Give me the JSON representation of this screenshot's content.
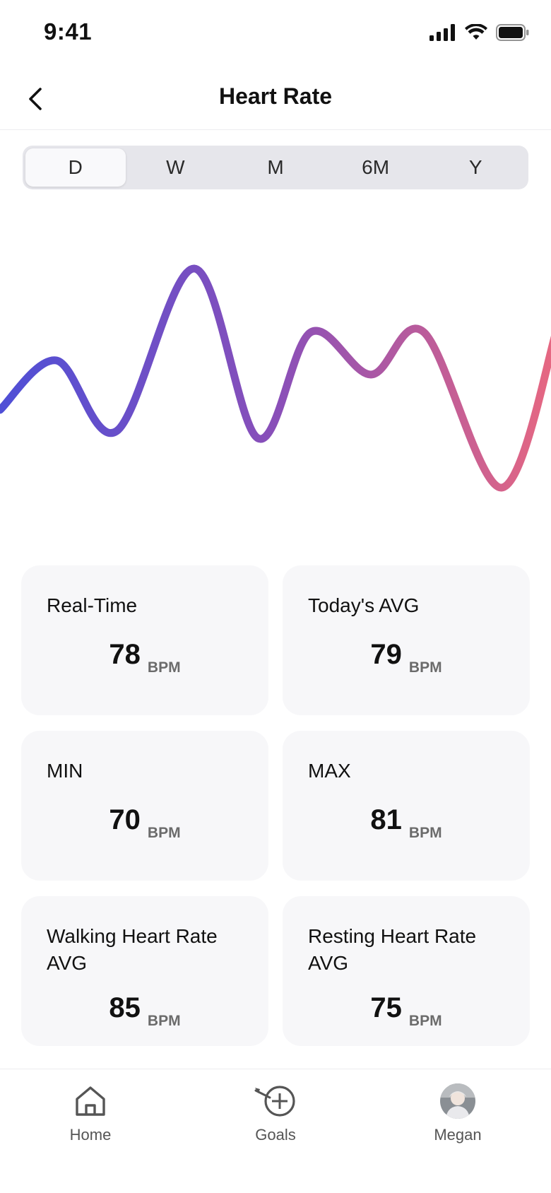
{
  "status_bar": {
    "time": "9:41"
  },
  "header": {
    "title": "Heart Rate"
  },
  "range_tabs": [
    {
      "label": "D",
      "active": true
    },
    {
      "label": "W",
      "active": false
    },
    {
      "label": "M",
      "active": false
    },
    {
      "label": "6M",
      "active": false
    },
    {
      "label": "Y",
      "active": false
    }
  ],
  "chart_data": {
    "type": "line",
    "x": [
      0,
      1,
      2,
      3,
      4,
      5,
      6,
      7,
      8,
      9
    ],
    "values": [
      74,
      77.5,
      72.5,
      84,
      72,
      79.5,
      76.5,
      79.5,
      68.5,
      80
    ],
    "xlabel": "",
    "ylabel": "",
    "ylim": [
      66,
      86
    ],
    "grid": false,
    "gradient": [
      "#4f4fd6",
      "#8a4fb8",
      "#e86880"
    ]
  },
  "cards": [
    {
      "label": "Real-Time",
      "value": "78",
      "unit": "BPM"
    },
    {
      "label": "Today's AVG",
      "value": "79",
      "unit": "BPM"
    },
    {
      "label": "MIN",
      "value": "70",
      "unit": "BPM"
    },
    {
      "label": "MAX",
      "value": "81",
      "unit": "BPM"
    },
    {
      "label": "Walking Heart Rate AVG",
      "value": "85",
      "unit": "BPM"
    },
    {
      "label": "Resting Heart Rate AVG",
      "value": "75",
      "unit": "BPM"
    }
  ],
  "tab_bar": {
    "home": {
      "label": "Home",
      "icon": "home-icon"
    },
    "goals": {
      "label": "Goals",
      "icon": "target-icon"
    },
    "profile": {
      "label": "Megan",
      "icon": "avatar"
    }
  }
}
